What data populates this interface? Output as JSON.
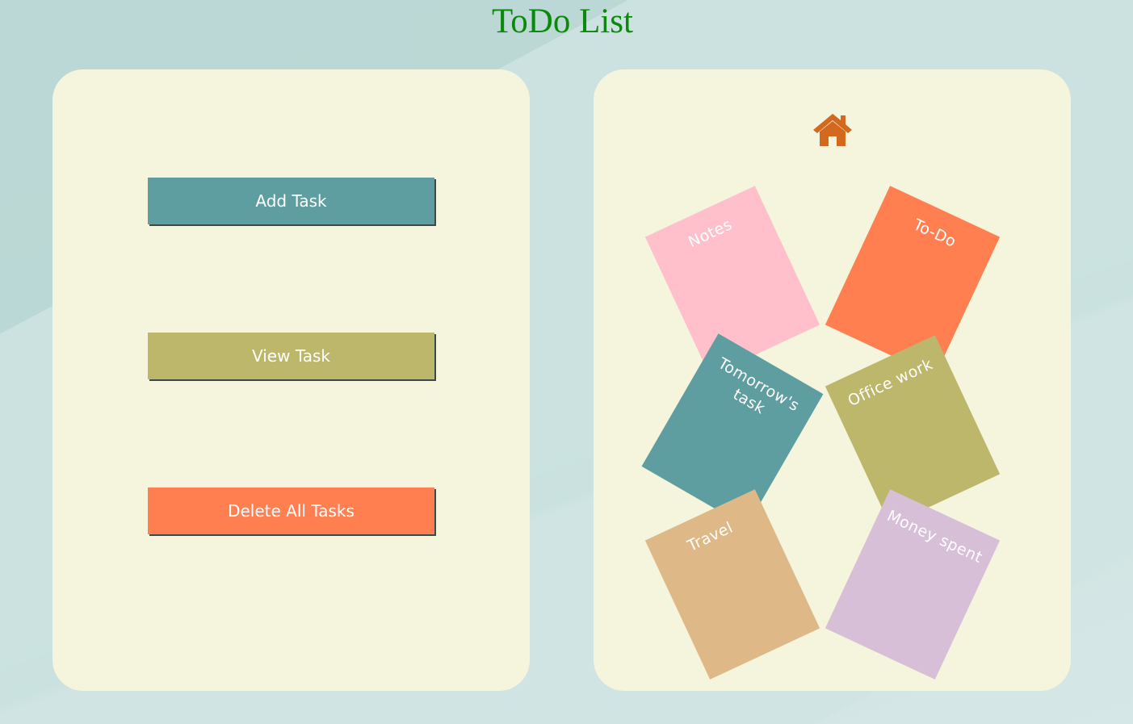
{
  "page": {
    "title": "ToDo List"
  },
  "actions": {
    "add_label": "Add Task",
    "view_label": "View Task",
    "delete_label": "Delete All Tasks"
  },
  "home": {
    "icon": "home-icon",
    "color": "#d2691e"
  },
  "notes": [
    {
      "label": "Notes",
      "color": "#ffc0cb"
    },
    {
      "label": "To-Do",
      "color": "#ff7f50"
    },
    {
      "label": "Tomorrow's task",
      "color": "#5f9ea0"
    },
    {
      "label": "Office work",
      "color": "#bdb76b"
    },
    {
      "label": "Travel",
      "color": "#deb887"
    },
    {
      "label": "Money spent",
      "color": "#d8bfd8"
    }
  ],
  "colors": {
    "title": "#0a8a0a",
    "panel": "#f5f4dc"
  }
}
